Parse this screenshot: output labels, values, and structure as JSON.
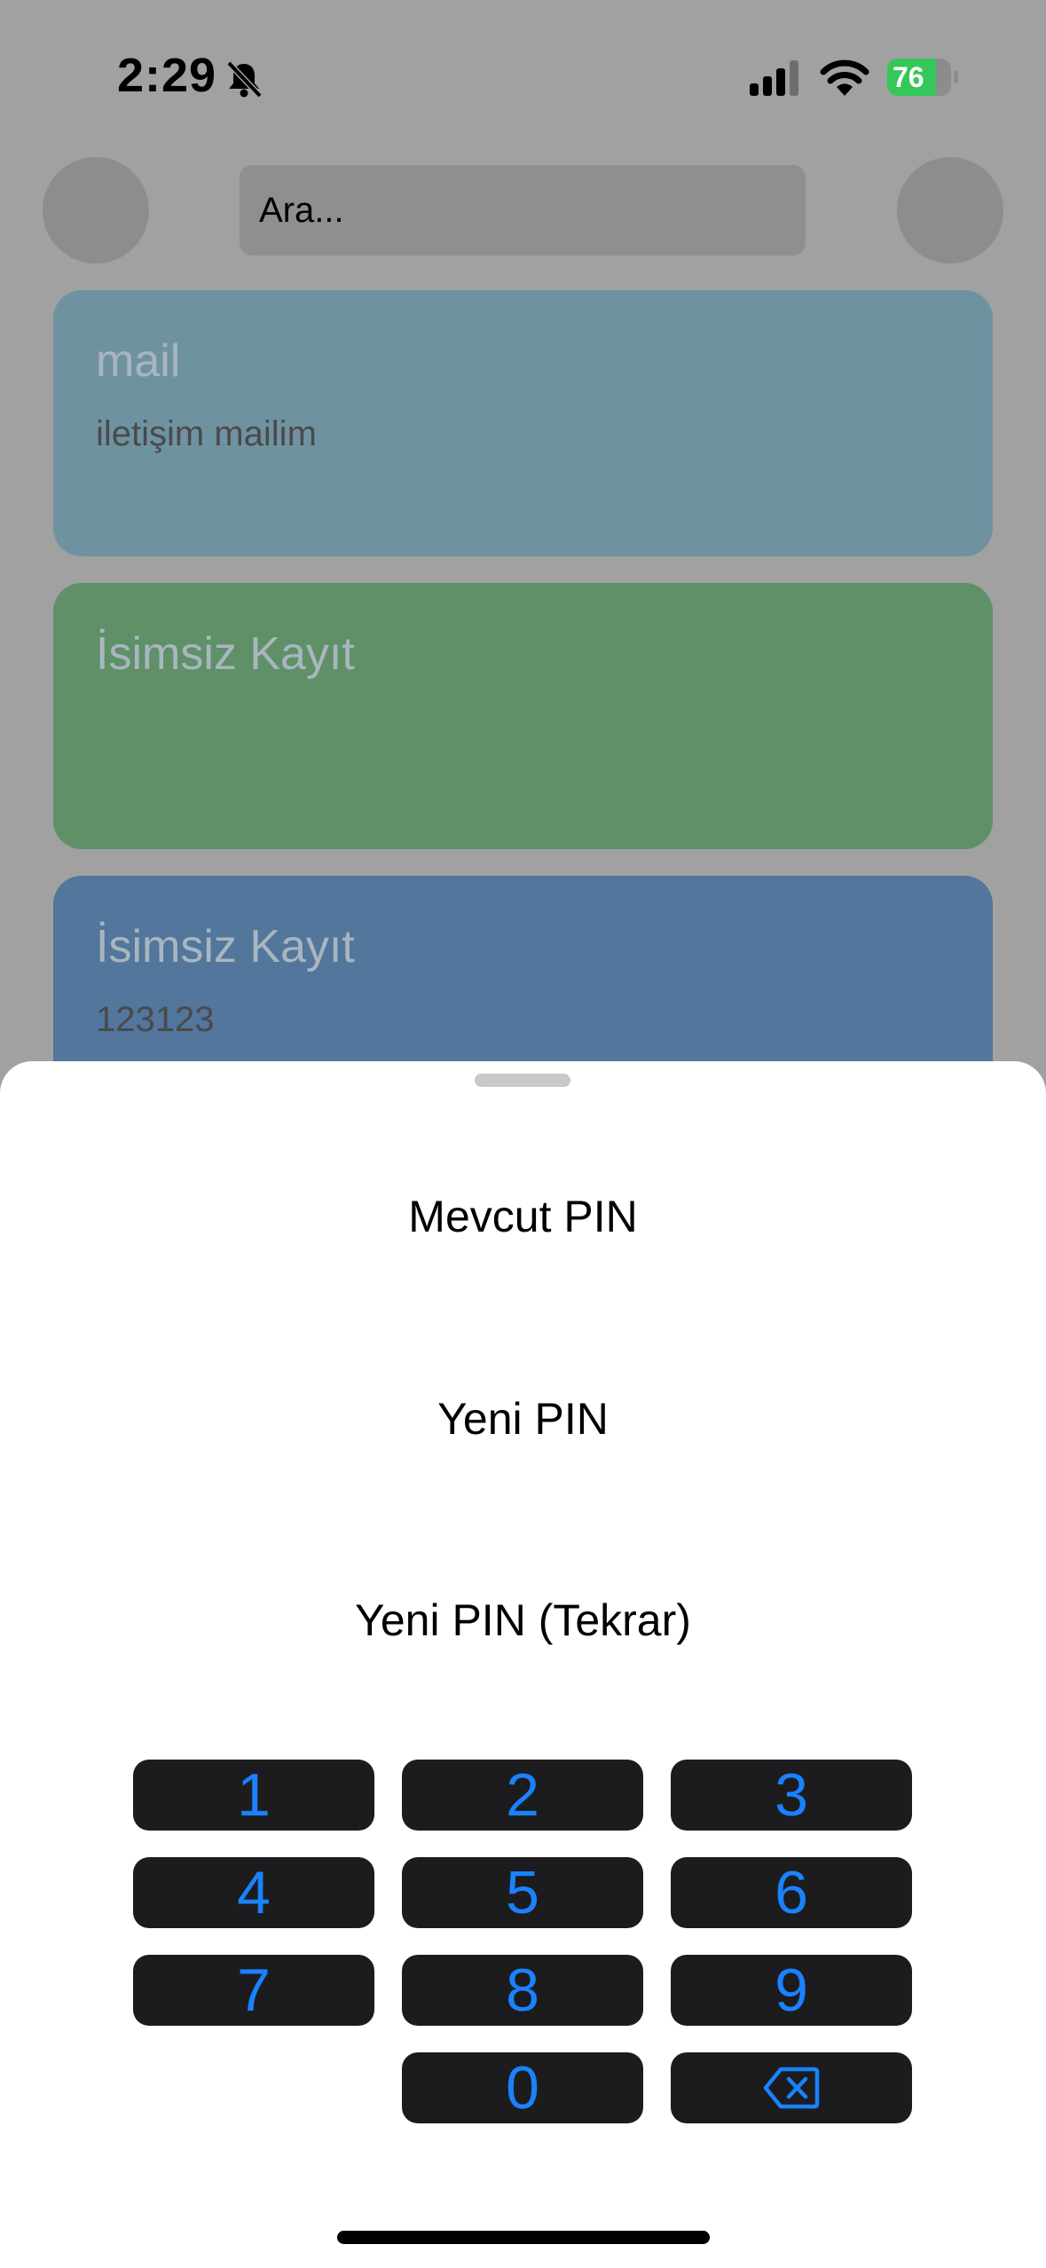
{
  "status_bar": {
    "time": "2:29",
    "battery": "76",
    "battery_level": 0.76,
    "silent_mode_icon": "bell-slash-icon"
  },
  "search": {
    "placeholder": "Ara..."
  },
  "cards": [
    {
      "title": "mail",
      "subtitle": "iletişim mailim",
      "color": "#6f92a1"
    },
    {
      "title": "İsimsiz Kayıt",
      "subtitle": "",
      "color": "#5f9068"
    },
    {
      "title": "İsimsiz Kayıt",
      "subtitle": "123123",
      "color": "#52769c"
    }
  ],
  "sheet": {
    "current_pin_label": "Mevcut PIN",
    "new_pin_label": "Yeni PIN",
    "confirm_pin_label": "Yeni PIN (Tekrar)"
  },
  "keypad": {
    "keys": [
      "1",
      "2",
      "3",
      "4",
      "5",
      "6",
      "7",
      "8",
      "9",
      "0"
    ],
    "delete_icon": "delete-left-icon",
    "key_color": "#1c1c1e",
    "digit_color": "#1a82ff"
  }
}
